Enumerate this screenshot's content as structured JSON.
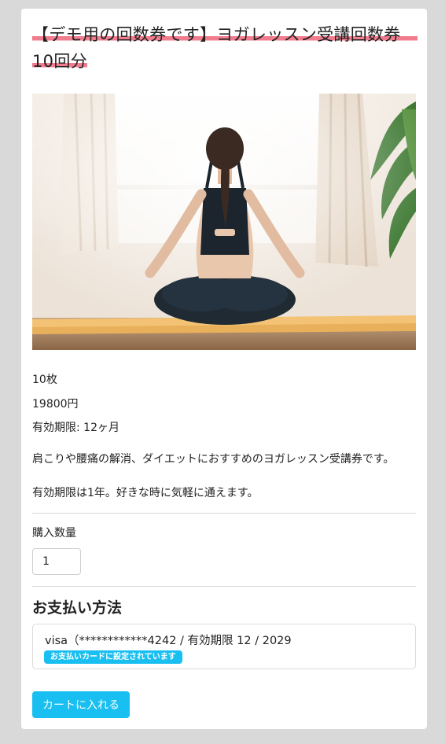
{
  "product": {
    "title": "【デモ用の回数券です】ヨガレッスン受講回数券　10回分",
    "image_alt": "ヨガをする女性",
    "count": "10枚",
    "price": "19800円",
    "validity": "有効期限: 12ヶ月",
    "description_1": "肩こりや腰痛の解消、ダイエットにおすすめのヨガレッスン受講券です。",
    "description_2": "有効期限は1年。好きな時に気軽に通えます。"
  },
  "purchase": {
    "quantity_label": "購入数量",
    "quantity_value": "1"
  },
  "payment": {
    "section_title": "お支払い方法",
    "card_text": "visa（************4242 / 有効期限 12 / 2029",
    "card_badge": "お支払いカードに設定されています"
  },
  "actions": {
    "add_to_cart_label": "カートに入れる"
  },
  "colors": {
    "accent": "#19bff0",
    "title_underline": "#f07c8e",
    "page_background": "#d9d9d9"
  }
}
